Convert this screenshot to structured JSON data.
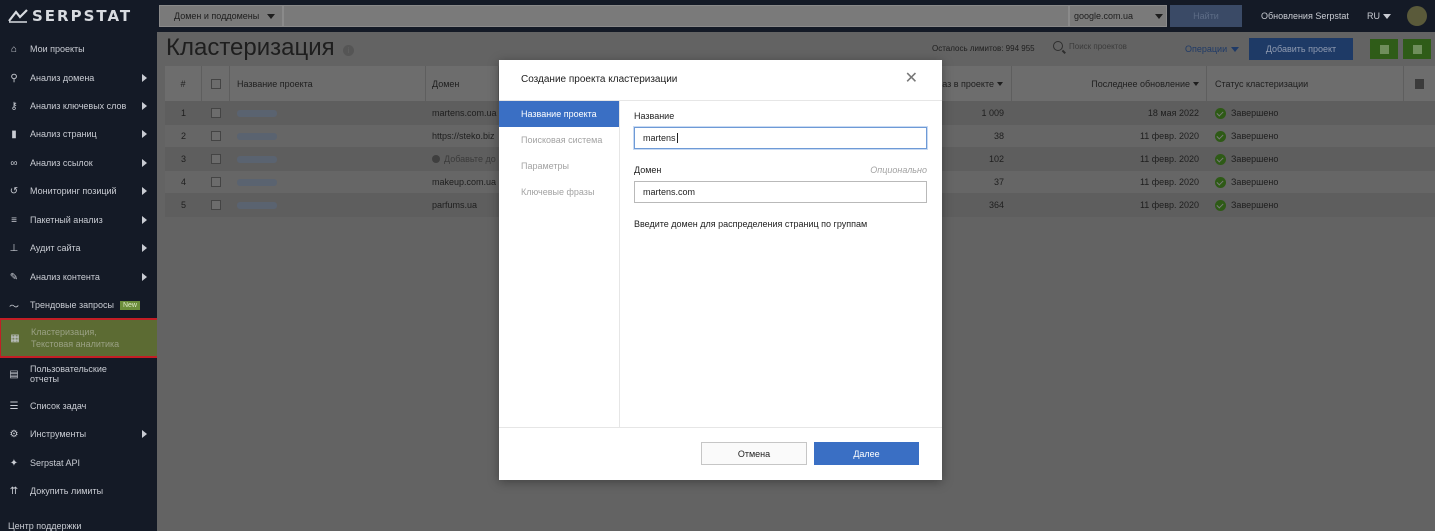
{
  "app": {
    "logo_text": "SERPSTAT"
  },
  "topbar": {
    "scope_select": "Домен и поддомены",
    "search_placeholder": "",
    "engine_select": "google.com.ua",
    "find_button": "Найти",
    "updates_link": "Обновления Serpstat",
    "language": "RU"
  },
  "sidebar": {
    "items": [
      {
        "label": "Мои проекты",
        "icon": "home-icon",
        "has_arrow": false
      },
      {
        "label": "Анализ домена",
        "icon": "domain-analysis-icon",
        "has_arrow": true
      },
      {
        "label": "Анализ ключевых слов",
        "icon": "key-icon",
        "has_arrow": true
      },
      {
        "label": "Анализ страниц",
        "icon": "bar-chart-icon",
        "has_arrow": true
      },
      {
        "label": "Анализ ссылок",
        "icon": "link-icon",
        "has_arrow": true
      },
      {
        "label": "Мониторинг позиций",
        "icon": "history-icon",
        "has_arrow": true
      },
      {
        "label": "Пакетный анализ",
        "icon": "database-icon",
        "has_arrow": true
      },
      {
        "label": "Аудит сайта",
        "icon": "sitemap-icon",
        "has_arrow": true
      },
      {
        "label": "Анализ контента",
        "icon": "pencil-icon",
        "has_arrow": true
      },
      {
        "label": "Трендовые запросы",
        "icon": "trend-icon",
        "has_arrow": false,
        "badge": "New"
      },
      {
        "label": "Кластеризация, Текстовая аналитика",
        "icon": "cluster-icon",
        "has_arrow": false,
        "active": true
      },
      {
        "label": "Пользовательские отчеты",
        "icon": "report-icon",
        "has_arrow": false
      },
      {
        "label": "Список задач",
        "icon": "list-icon",
        "has_arrow": false
      },
      {
        "label": "Инструменты",
        "icon": "gear-icon",
        "has_arrow": true
      },
      {
        "label": "Serpstat API",
        "icon": "api-icon",
        "has_arrow": false
      },
      {
        "label": "Докупить лимиты",
        "icon": "limits-icon",
        "has_arrow": false
      }
    ],
    "support": "Центр поддержки"
  },
  "page": {
    "title": "Кластеризация",
    "limits_text": "Осталось лимитов: 994 955",
    "search_projects": "Поиск проектов",
    "operations": "Операции",
    "add_project": "Добавить проект"
  },
  "table": {
    "headers": {
      "num": "#",
      "name": "Название проекта",
      "domain": "Домен",
      "phrases": "аз в проекте",
      "updated": "Последнее обновление",
      "status": "Статус кластеризации"
    },
    "rows": [
      {
        "num": "1",
        "domain": "martens.com.ua",
        "phrases": "1 009",
        "updated": "18 мая 2022",
        "status": "Завершено"
      },
      {
        "num": "2",
        "domain": "https://steko.biz",
        "phrases": "38",
        "updated": "11 февр. 2020",
        "status": "Завершено"
      },
      {
        "num": "3",
        "domain": "Добавьте до",
        "phrases": "102",
        "updated": "11 февр. 2020",
        "status": "Завершено"
      },
      {
        "num": "4",
        "domain": "makeup.com.ua",
        "phrases": "37",
        "updated": "11 февр. 2020",
        "status": "Завершено"
      },
      {
        "num": "5",
        "domain": "parfums.ua",
        "phrases": "364",
        "updated": "11 февр. 2020",
        "status": "Завершено"
      }
    ]
  },
  "modal": {
    "title": "Создание проекта кластеризации",
    "steps": [
      "Название проекта",
      "Поисковая система",
      "Параметры",
      "Ключевые фразы"
    ],
    "name_label": "Название",
    "name_value": "martens",
    "domain_label": "Домен",
    "domain_optional": "Опционально",
    "domain_value": "martens.com",
    "hint": "Введите домен для распределения страниц по группам",
    "cancel": "Отмена",
    "next": "Далее"
  },
  "colors": {
    "sidebar_bg": "#141a26",
    "overlay_bg": "#636363",
    "primary_button": "#3a6fc4",
    "active_nav": "#5c6b33",
    "highlight_border": "#c21e25"
  }
}
